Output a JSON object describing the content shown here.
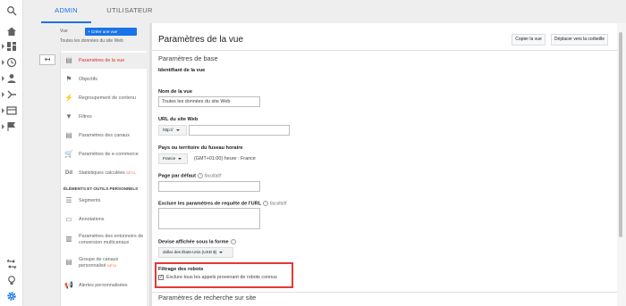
{
  "tabs": {
    "admin": "ADMIN",
    "user": "UTILISATEUR"
  },
  "rail": {
    "icons": [
      "search-icon",
      "home-icon",
      "dashboard-icon",
      "clock-icon",
      "person-icon",
      "acquisition-icon",
      "behavior-icon",
      "flag-icon",
      "connect-icon",
      "lightbulb-icon",
      "gear-icon"
    ]
  },
  "view": {
    "label": "Vue",
    "create_button": "+ Créer une vue",
    "current": "Toutes les données du site Web"
  },
  "menu": {
    "items": [
      {
        "label": "Paramètres de la vue",
        "icon": "document-icon"
      },
      {
        "label": "Objectifs",
        "icon": "flag-icon"
      },
      {
        "label": "Regroupement de contenu",
        "icon": "person-run-icon"
      },
      {
        "label": "Filtres",
        "icon": "filter-icon"
      },
      {
        "label": "Paramètres des canaux",
        "icon": "document-icon"
      },
      {
        "label": "Paramètres de e-commerce",
        "icon": "cart-icon"
      },
      {
        "label": "Statistiques calculées",
        "icon": "dd-icon",
        "badge": "BÊTA"
      }
    ],
    "section_header": "ÉLÉMENTS ET OUTILS PERSONNELS",
    "personal_items": [
      {
        "label": "Segments",
        "icon": "segments-icon"
      },
      {
        "label": "Annotations",
        "icon": "comment-icon"
      },
      {
        "label": "Paramètres des entonnoirs de conversion multicanaux",
        "icon": "bar-chart-icon"
      },
      {
        "label": "Groupe de canaux personnalisé",
        "icon": "document-icon",
        "badge": "BÊTA"
      },
      {
        "label": "Alertes personnalisées",
        "icon": "megaphone-icon"
      }
    ]
  },
  "panel": {
    "title": "Paramètres de la vue",
    "copy_button": "Copier la vue",
    "trash_button": "Déplacer vers la corbeille",
    "basic_section": "Paramètres de base",
    "view_id_label": "Identifiant de la vue",
    "view_name_label": "Nom de la vue",
    "view_name_value": "Toutes les données du site Web",
    "site_url_label": "URL du site Web",
    "protocol_value": "http://",
    "timezone_label": "Pays ou territoire du fuseau horaire",
    "country_value": "France",
    "timezone_value": "(GMT+01:00) heure : France",
    "default_page_label": "Page par défaut",
    "optional": "facultatif",
    "exclude_label": "Exclure les paramètres de requête de l'URL",
    "currency_label": "Devise affichée sous la forme",
    "currency_value": "dollar des États-Unis (USD $)",
    "robots_label": "Filtrage des robots",
    "robots_checkbox": "Exclure tous les appels provenant de robots connus",
    "search_section": "Paramètres de recherche sur site",
    "help": "?"
  },
  "colors": {
    "accent": "#1a73e8",
    "active": "#d93025",
    "highlight": "#e53935"
  }
}
